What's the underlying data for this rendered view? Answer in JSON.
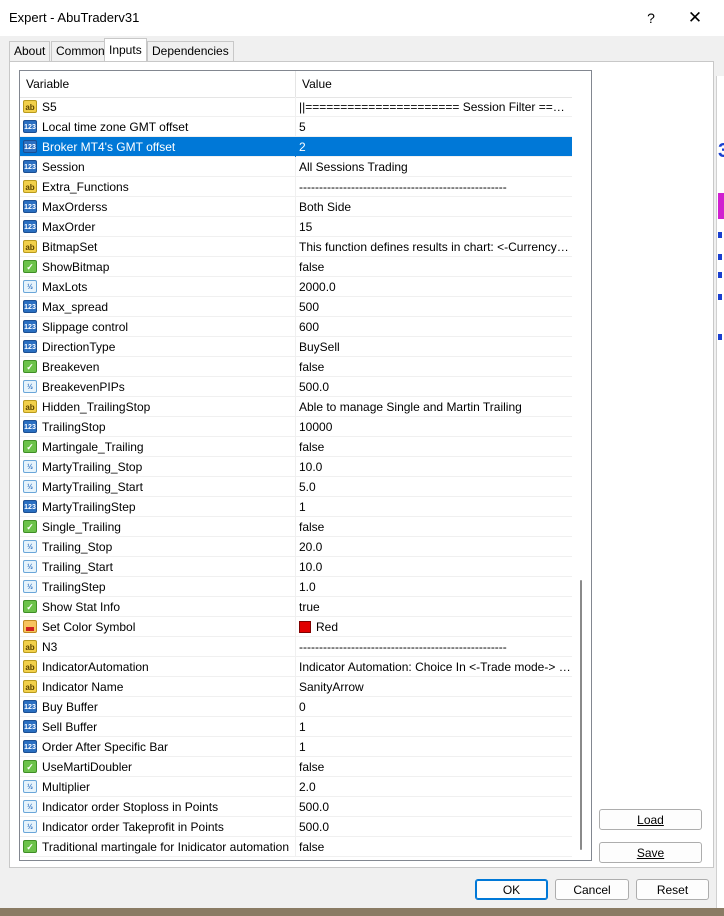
{
  "window": {
    "title": "Expert - AbuTraderv31",
    "help_label": "?",
    "close_label": "✕"
  },
  "tabs": [
    {
      "label": "About",
      "active": false
    },
    {
      "label": "Common",
      "active": false
    },
    {
      "label": "Inputs",
      "active": true
    },
    {
      "label": "Dependencies",
      "active": false
    }
  ],
  "grid": {
    "col_variable": "Variable",
    "col_value": "Value",
    "rows": [
      {
        "icon": "str",
        "name": "S5",
        "value": "||====================== Session Filter ===========================||"
      },
      {
        "icon": "int",
        "name": "Local time zone GMT offset",
        "value": "5"
      },
      {
        "icon": "int",
        "name": "Broker MT4's GMT offset",
        "value": "2",
        "selected": true
      },
      {
        "icon": "int",
        "name": "Session",
        "value": "All Sessions Trading"
      },
      {
        "icon": "str",
        "name": "Extra_Functions",
        "value": "----------------------------------------------------"
      },
      {
        "icon": "int",
        "name": "MaxOrderss",
        "value": "Both Side"
      },
      {
        "icon": "int",
        "name": "MaxOrder",
        "value": "15"
      },
      {
        "icon": "str",
        "name": "BitmapSet",
        "value": "This function defines results in chart: <-Currency / Pips->"
      },
      {
        "icon": "bool",
        "name": "ShowBitmap",
        "value": "false"
      },
      {
        "icon": "dbl",
        "name": "MaxLots",
        "value": "2000.0"
      },
      {
        "icon": "int",
        "name": "Max_spread",
        "value": "500"
      },
      {
        "icon": "int",
        "name": "Slippage control",
        "value": "600"
      },
      {
        "icon": "int",
        "name": "DirectionType",
        "value": "BuySell"
      },
      {
        "icon": "bool",
        "name": "Breakeven",
        "value": "false"
      },
      {
        "icon": "dbl",
        "name": "BreakevenPIPs",
        "value": "500.0"
      },
      {
        "icon": "str",
        "name": "Hidden_TrailingStop",
        "value": "Able to manage Single and Martin Trailing"
      },
      {
        "icon": "int",
        "name": "TrailingStop",
        "value": "10000"
      },
      {
        "icon": "bool",
        "name": "Martingale_Trailing",
        "value": "false"
      },
      {
        "icon": "dbl",
        "name": "MartyTrailing_Stop",
        "value": "10.0"
      },
      {
        "icon": "dbl",
        "name": "MartyTrailing_Start",
        "value": "5.0"
      },
      {
        "icon": "int",
        "name": "MartyTrailingStep",
        "value": "1"
      },
      {
        "icon": "bool",
        "name": "Single_Trailing",
        "value": "false"
      },
      {
        "icon": "dbl",
        "name": "Trailing_Stop",
        "value": "20.0"
      },
      {
        "icon": "dbl",
        "name": "Trailing_Start",
        "value": "10.0"
      },
      {
        "icon": "dbl",
        "name": "TrailingStep",
        "value": "1.0"
      },
      {
        "icon": "bool",
        "name": "Show Stat Info",
        "value": "true"
      },
      {
        "icon": "color",
        "name": "Set Color Symbol",
        "value": "Red",
        "swatch": "#e00000"
      },
      {
        "icon": "str",
        "name": "N3",
        "value": "----------------------------------------------------"
      },
      {
        "icon": "str",
        "name": "IndicatorAutomation",
        "value": "Indicator Automation: Choice In <-Trade mode-> section..."
      },
      {
        "icon": "str",
        "name": "Indicator Name",
        "value": "SanityArrow"
      },
      {
        "icon": "int",
        "name": "Buy Buffer",
        "value": "0"
      },
      {
        "icon": "int",
        "name": "Sell Buffer",
        "value": "1"
      },
      {
        "icon": "int",
        "name": "Order After Specific Bar",
        "value": "1"
      },
      {
        "icon": "bool",
        "name": "UseMartiDoubler",
        "value": "false"
      },
      {
        "icon": "dbl",
        "name": "Multiplier",
        "value": "2.0"
      },
      {
        "icon": "dbl",
        "name": "Indicator order Stoploss in Points",
        "value": "500.0"
      },
      {
        "icon": "dbl",
        "name": "Indicator order Takeprofit in Points",
        "value": "500.0"
      },
      {
        "icon": "bool",
        "name": "Traditional martingale for Inidicator automation",
        "value": "false"
      }
    ]
  },
  "icon_glyphs": {
    "int": "123",
    "dbl": "½",
    "str": "ab",
    "bool": "✓",
    "color": ""
  },
  "side_buttons": {
    "load_label": "Load",
    "save_label": "Save"
  },
  "footer": {
    "ok_label": "OK",
    "cancel_label": "Cancel",
    "reset_label": "Reset"
  },
  "colors": {
    "selection": "#0078d7",
    "accent": "#0078d7"
  }
}
